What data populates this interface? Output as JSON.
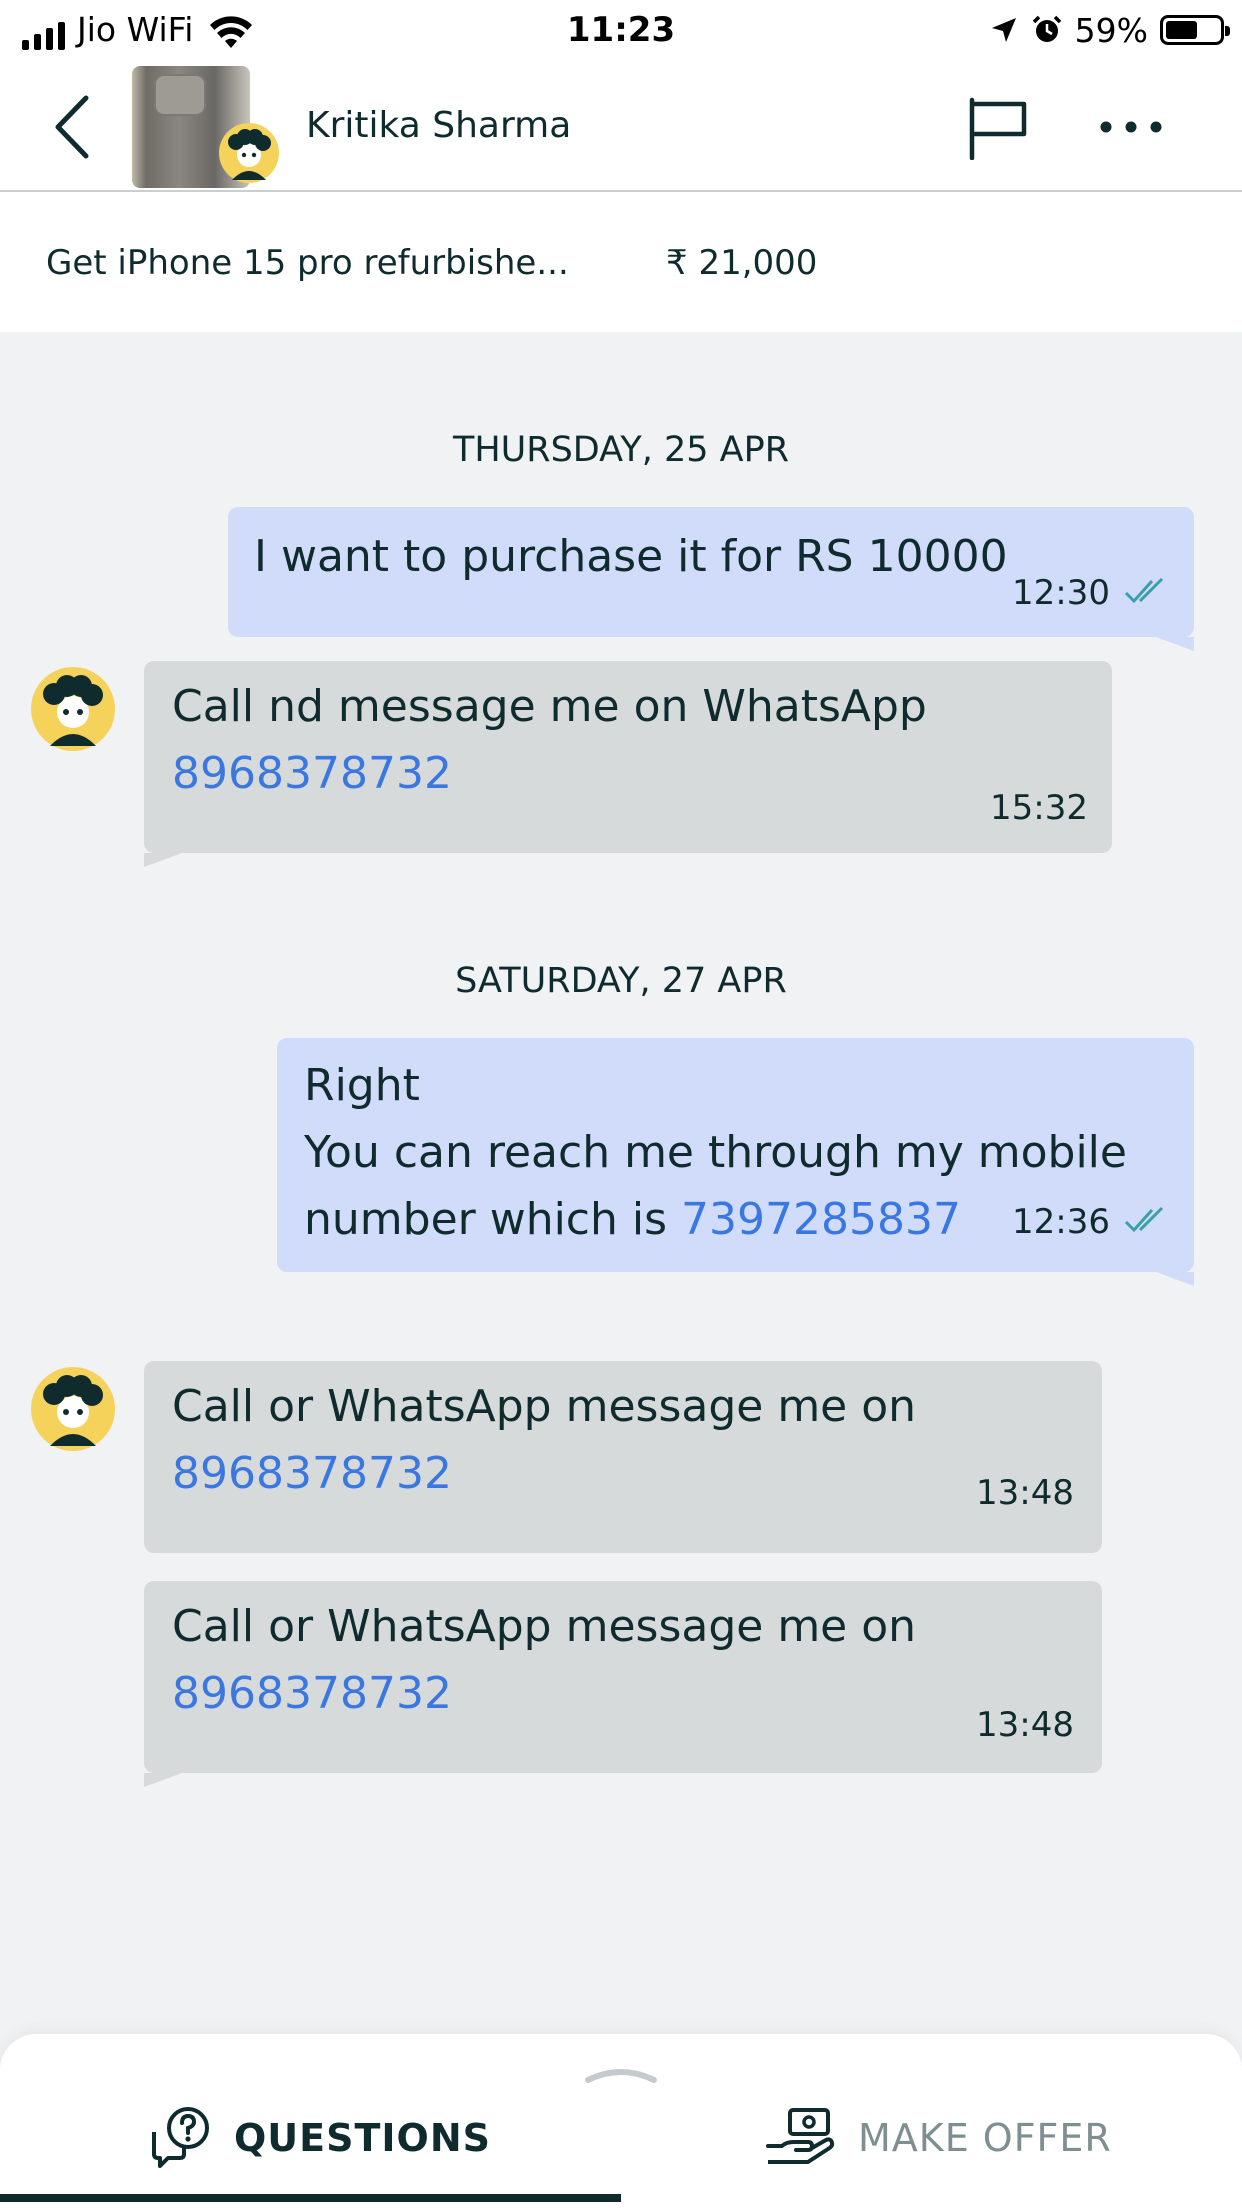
{
  "status_bar": {
    "carrier": "Jio WiFi",
    "time": "11:23",
    "battery_percent": "59%",
    "battery_level": 0.59
  },
  "header": {
    "seller_name": "Kritika Sharma"
  },
  "product": {
    "title": "Get iPhone 15 pro refurbishe...",
    "price": "₹ 21,000"
  },
  "chat": {
    "date_1": "THURSDAY, 25 APR",
    "date_2": "SATURDAY, 27 APR",
    "messages": [
      {
        "direction": "sent",
        "text": "I want to purchase it for RS 10000",
        "time": "12:30"
      },
      {
        "direction": "received",
        "text": "Call nd message me on WhatsApp",
        "phone": "8968378732",
        "time": "15:32"
      },
      {
        "direction": "sent",
        "line1": "Right",
        "line2": "You can reach me through my mobile",
        "line3_prefix": "number which is ",
        "phone": "7397285837",
        "time": "12:36"
      },
      {
        "direction": "received",
        "text": "Call or WhatsApp message me on",
        "phone": "8968378732",
        "time": "13:48"
      },
      {
        "direction": "received",
        "text": "Call or WhatsApp message me on",
        "phone": "8968378732",
        "time": "13:48"
      }
    ]
  },
  "bottom_bar": {
    "questions_label": "QUESTIONS",
    "make_offer_label": "MAKE OFFER",
    "active_tab": "QUESTIONS"
  },
  "colors": {
    "sent_bubble": "#d1dcfa",
    "received_bubble": "#d6dadb",
    "link": "#3a77e0",
    "text": "#0f2b2e",
    "tick": "#3a9fa8"
  }
}
